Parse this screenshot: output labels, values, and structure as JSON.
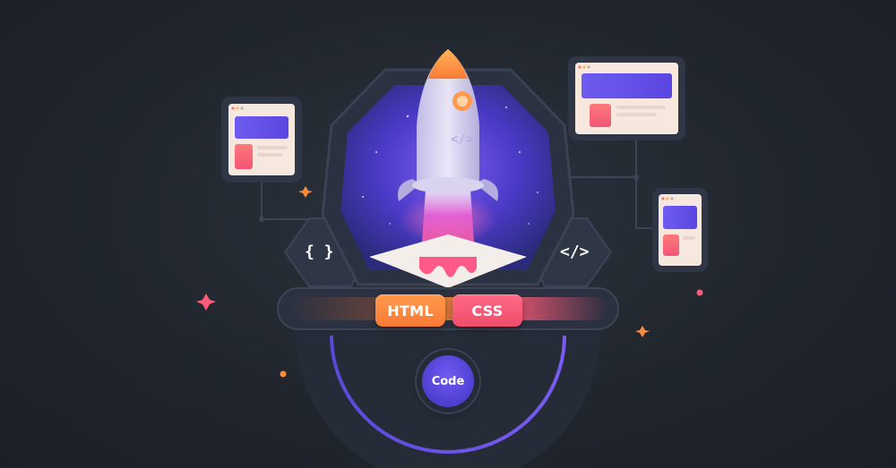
{
  "badges": {
    "html_label": "HTML",
    "css_label": "CSS",
    "code_label": "Code"
  },
  "glyphs": {
    "left_bracket_glyph": "{ }",
    "right_bracket_glyph": "</>",
    "rocket_glyph": "</>"
  },
  "colors": {
    "background": "#21262e",
    "accent_purple": "#5b46e0",
    "accent_orange": "#f98a3c",
    "accent_pink": "#ef4d6c",
    "panel": "#2d3442"
  },
  "icons": [
    "rocket-icon",
    "braces-icon",
    "code-slash-icon",
    "browser-window-icon",
    "mobile-window-icon",
    "sparkle-icon"
  ]
}
